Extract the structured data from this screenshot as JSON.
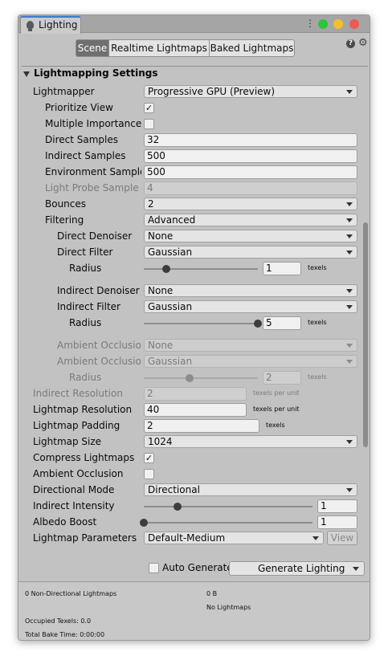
{
  "window": {
    "tab_title": "Lighting",
    "tab_icon": "lightbulb-icon",
    "traffic_lights": {
      "green": "#2ec440",
      "yellow": "#f2c02a",
      "red": "#ee5b55"
    }
  },
  "toolbar": {
    "tabs": [
      "Scene",
      "Realtime Lightmaps",
      "Baked Lightmaps"
    ],
    "selected": "Scene"
  },
  "section": {
    "title": "Lightmapping Settings"
  },
  "rows": {
    "lightmapper": {
      "label": "Lightmapper",
      "value": "Progressive GPU (Preview)"
    },
    "prioritize_view": {
      "label": "Prioritize View",
      "checked": "✓"
    },
    "mis": {
      "label": "Multiple Importance Sa",
      "checked": ""
    },
    "direct_samples": {
      "label": "Direct Samples",
      "value": "32"
    },
    "indirect_samples": {
      "label": "Indirect Samples",
      "value": "500"
    },
    "env_samples": {
      "label": "Environment Samples",
      "value": "500"
    },
    "light_probe": {
      "label": "Light Probe Sample Mu",
      "value": "4"
    },
    "bounces": {
      "label": "Bounces",
      "value": "2"
    },
    "filtering": {
      "label": "Filtering",
      "value": "Advanced"
    },
    "direct_denoiser": {
      "label": "Direct Denoiser",
      "value": "None"
    },
    "direct_filter": {
      "label": "Direct Filter",
      "value": "Gaussian"
    },
    "direct_radius": {
      "label": "Radius",
      "value": "1",
      "unit": "texels",
      "slider_fraction": 0.2
    },
    "indirect_denoiser": {
      "label": "Indirect Denoiser",
      "value": "None"
    },
    "indirect_filter": {
      "label": "Indirect Filter",
      "value": "Gaussian"
    },
    "indirect_radius": {
      "label": "Radius",
      "value": "5",
      "unit": "texels",
      "slider_fraction": 1.0
    },
    "ao_denoiser": {
      "label": "Ambient Occlusion",
      "value": "None"
    },
    "ao_filter": {
      "label": "Ambient Occlusion",
      "value": "Gaussian"
    },
    "ao_radius": {
      "label": "Radius",
      "value": "2",
      "unit": "texels",
      "slider_fraction": 0.4
    },
    "indirect_resolution": {
      "label": "Indirect Resolution",
      "value": "2",
      "unit": "texels per unit"
    },
    "lightmap_resolution": {
      "label": "Lightmap Resolution",
      "value": "40",
      "unit": "texels per unit"
    },
    "lightmap_padding": {
      "label": "Lightmap Padding",
      "value": "2",
      "unit": "texels"
    },
    "lightmap_size": {
      "label": "Lightmap Size",
      "value": "1024"
    },
    "compress": {
      "label": "Compress Lightmaps",
      "checked": "✓"
    },
    "ambient_occlusion": {
      "label": "Ambient Occlusion",
      "checked": ""
    },
    "directional_mode": {
      "label": "Directional Mode",
      "value": "Directional"
    },
    "indirect_intensity": {
      "label": "Indirect Intensity",
      "value": "1",
      "slider_fraction": 0.2
    },
    "albedo_boost": {
      "label": "Albedo Boost",
      "value": "1",
      "slider_fraction": 0.0
    },
    "lightmap_parameters": {
      "label": "Lightmap Parameters",
      "value": "Default-Medium",
      "view_label": "View"
    }
  },
  "footer": {
    "auto_generate": {
      "label": "Auto Generate",
      "checked": ""
    },
    "generate_button": "Generate Lighting"
  },
  "stats": {
    "non_directional": "0 Non-Directional Lightmaps",
    "size": "0 B",
    "no_lightmaps": "No Lightmaps",
    "occupied": "Occupied Texels: 0.0",
    "bake_time": "Total Bake Time: 0:00:00"
  }
}
